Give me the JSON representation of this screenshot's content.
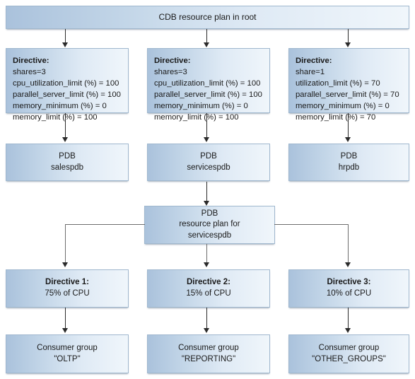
{
  "diagram": {
    "title": "CDB resource plan in root",
    "root": {
      "label": "CDB resource plan in root"
    },
    "cdb_directives": [
      {
        "name": "directive-salespdb",
        "heading": "Directive:",
        "lines": [
          "shares=3",
          "cpu_utilization_limit (%) = 100",
          "parallel_server_limit (%) = 100",
          "memory_minimum (%) = 0",
          "memory_limit (%) = 100"
        ]
      },
      {
        "name": "directive-servicespdb",
        "heading": "Directive:",
        "lines": [
          "shares=3",
          "cpu_utilization_limit (%) = 100",
          "parallel_server_limit (%) = 100",
          "memory_minimum (%) = 0",
          "memory_limit (%) = 100"
        ]
      },
      {
        "name": "directive-hrpdb",
        "heading": "Directive:",
        "lines": [
          "share=1",
          "utilization_limit (%) = 70",
          "parallel_server_limit (%) = 70",
          "memory_minimum (%) = 0",
          "memory_limit (%) = 70"
        ]
      }
    ],
    "pdbs": [
      {
        "line1": "PDB",
        "line2": "salespdb"
      },
      {
        "line1": "PDB",
        "line2": "servicespdb"
      },
      {
        "line1": "PDB",
        "line2": "hrpdb"
      }
    ],
    "pdb_plan": {
      "line1": "PDB",
      "line2": "resource plan for",
      "line3": "servicespdb"
    },
    "pdb_directives": [
      {
        "heading": "Directive 1:",
        "detail": "75% of CPU"
      },
      {
        "heading": "Directive 2:",
        "detail": "15% of CPU"
      },
      {
        "heading": "Directive 3:",
        "detail": "10% of CPU"
      }
    ],
    "consumer_groups": [
      {
        "line1": "Consumer group",
        "line2": "\"OLTP\""
      },
      {
        "line1": "Consumer group",
        "line2": "\"REPORTING\""
      },
      {
        "line1": "Consumer group",
        "line2": "\"OTHER_GROUPS\""
      }
    ],
    "colors": {
      "box_gradient_start": "#aac2dc",
      "box_gradient_end": "#f0f6fb",
      "box_border": "#9fb7ce",
      "arrow": "#2b2b2b",
      "connector": "#6d6d6d",
      "background": "#ffffff"
    }
  }
}
